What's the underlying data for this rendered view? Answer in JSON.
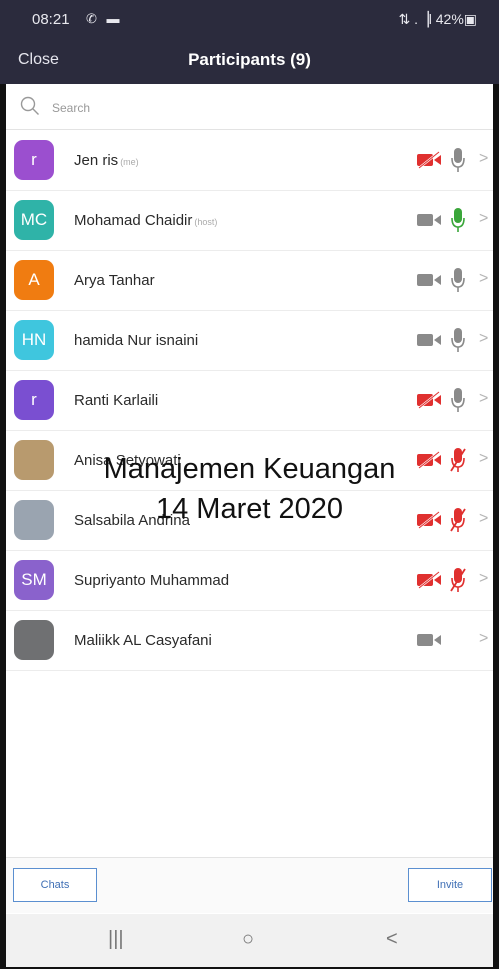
{
  "status_bar": {
    "time": "08:21",
    "left_icons": "✆ ▬",
    "right": "⇅ .▕l 42%▣"
  },
  "header": {
    "close_label": "Close",
    "title": "Participants (9)"
  },
  "search": {
    "placeholder": "Search"
  },
  "participants": [
    {
      "name": "Jen ris",
      "tag": "(me)",
      "initials": "r",
      "avatar_color": "#9b4fcf",
      "video": "off",
      "audio": "muted-idle"
    },
    {
      "name": "Mohamad Chaidir",
      "tag": "(host)",
      "initials": "MC",
      "avatar_color": "#2fb3a8",
      "video": "on",
      "audio": "active"
    },
    {
      "name": "Arya Tanhar",
      "tag": "",
      "initials": "A",
      "avatar_color": "#f07c11",
      "video": "on",
      "audio": "idle"
    },
    {
      "name": "hamida Nur isnaini",
      "tag": "",
      "initials": "HN",
      "avatar_color": "#3fc6de",
      "video": "on",
      "audio": "idle"
    },
    {
      "name": "Ranti Karlaili",
      "tag": "",
      "initials": "r",
      "avatar_color": "#7a4fd1",
      "video": "off",
      "audio": "idle"
    },
    {
      "name": "Anisa Setyowati",
      "tag": "",
      "initials": "",
      "avatar_color": "#b89a6e",
      "video": "off",
      "audio": "muted"
    },
    {
      "name": "Salsabila Andrina",
      "tag": "",
      "initials": "",
      "avatar_color": "#9aa4b0",
      "video": "off",
      "audio": "muted"
    },
    {
      "name": "Supriyanto Muhammad",
      "tag": "",
      "initials": "SM",
      "avatar_color": "#8a62cc",
      "video": "off",
      "audio": "muted"
    },
    {
      "name": "Maliikk AL Casyafani",
      "tag": "",
      "initials": "",
      "avatar_color": "#6f7072",
      "video": "on",
      "audio": "none"
    }
  ],
  "overlay": {
    "line1": "Manajemen Keuangan",
    "line2": "14 Maret 2020"
  },
  "footer": {
    "chats_label": "Chats",
    "invite_label": "Invite"
  },
  "system_nav": {
    "recents": "|||",
    "home": "○",
    "back": "<"
  },
  "colors": {
    "header_bg": "#2b2b3d",
    "muted_red": "#e0302f",
    "active_green": "#3aa63a",
    "icon_gray": "#8a8a8a",
    "button_blue": "#3f6fb5"
  }
}
